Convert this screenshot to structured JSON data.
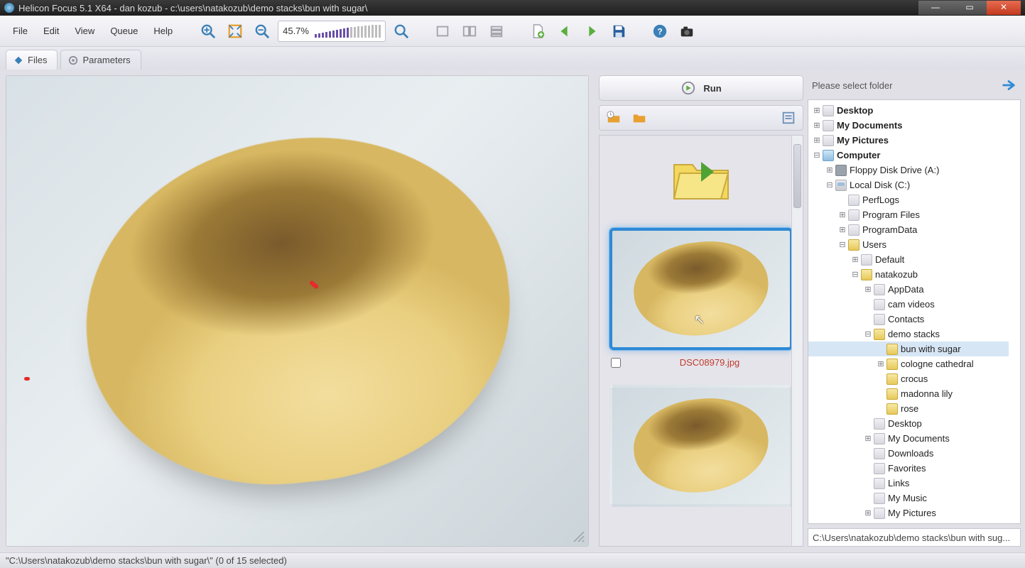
{
  "window": {
    "title": "Helicon Focus 5.1 X64 - dan kozub - c:\\users\\natakozub\\demo stacks\\bun with sugar\\"
  },
  "menu": {
    "file": "File",
    "edit": "Edit",
    "view": "View",
    "queue": "Queue",
    "help": "Help"
  },
  "toolbar": {
    "zoom_percent": "45.7%"
  },
  "tabs": {
    "files": "Files",
    "parameters": "Parameters"
  },
  "midpanel": {
    "run_label": "Run",
    "thumb_filename": "DSC08979.jpg"
  },
  "rightpanel": {
    "header": "Please select folder",
    "path": "C:\\Users\\natakozub\\demo stacks\\bun with sug..."
  },
  "tree": [
    {
      "d": 0,
      "tw": "+",
      "ic": "folder closed",
      "bold": true,
      "label": "Desktop"
    },
    {
      "d": 0,
      "tw": "+",
      "ic": "folder closed",
      "bold": true,
      "label": "My Documents"
    },
    {
      "d": 0,
      "tw": "+",
      "ic": "folder closed",
      "bold": true,
      "label": "My Pictures"
    },
    {
      "d": 0,
      "tw": "-",
      "ic": "pc",
      "bold": true,
      "label": "Computer"
    },
    {
      "d": 1,
      "tw": "+",
      "ic": "floppy",
      "label": "Floppy Disk Drive (A:)"
    },
    {
      "d": 1,
      "tw": "-",
      "ic": "drive",
      "label": "Local Disk (C:)"
    },
    {
      "d": 2,
      "tw": " ",
      "ic": "folder closed",
      "label": "PerfLogs"
    },
    {
      "d": 2,
      "tw": "+",
      "ic": "folder closed",
      "label": "Program Files"
    },
    {
      "d": 2,
      "tw": "+",
      "ic": "folder closed",
      "label": "ProgramData"
    },
    {
      "d": 2,
      "tw": "-",
      "ic": "folder",
      "label": "Users"
    },
    {
      "d": 3,
      "tw": "+",
      "ic": "folder closed",
      "label": "Default"
    },
    {
      "d": 3,
      "tw": "-",
      "ic": "folder",
      "label": "natakozub"
    },
    {
      "d": 4,
      "tw": "+",
      "ic": "folder closed",
      "label": "AppData"
    },
    {
      "d": 4,
      "tw": " ",
      "ic": "folder closed",
      "label": "cam videos"
    },
    {
      "d": 4,
      "tw": " ",
      "ic": "folder closed",
      "label": "Contacts"
    },
    {
      "d": 4,
      "tw": "-",
      "ic": "folder",
      "label": "demo stacks"
    },
    {
      "d": 5,
      "tw": " ",
      "ic": "folder",
      "sel": true,
      "label": "bun with sugar"
    },
    {
      "d": 5,
      "tw": "+",
      "ic": "folder",
      "label": "cologne cathedral"
    },
    {
      "d": 5,
      "tw": " ",
      "ic": "folder",
      "label": "crocus"
    },
    {
      "d": 5,
      "tw": " ",
      "ic": "folder",
      "label": "madonna lily"
    },
    {
      "d": 5,
      "tw": " ",
      "ic": "folder",
      "label": "rose"
    },
    {
      "d": 4,
      "tw": " ",
      "ic": "folder closed",
      "label": "Desktop"
    },
    {
      "d": 4,
      "tw": "+",
      "ic": "folder closed",
      "label": "My Documents"
    },
    {
      "d": 4,
      "tw": " ",
      "ic": "folder closed",
      "label": "Downloads"
    },
    {
      "d": 4,
      "tw": " ",
      "ic": "folder closed",
      "label": "Favorites"
    },
    {
      "d": 4,
      "tw": " ",
      "ic": "folder closed",
      "label": "Links"
    },
    {
      "d": 4,
      "tw": " ",
      "ic": "folder closed",
      "label": "My Music"
    },
    {
      "d": 4,
      "tw": "+",
      "ic": "folder closed",
      "label": "My Pictures"
    }
  ],
  "status": {
    "text": "\"C:\\Users\\natakozub\\demo stacks\\bun with sugar\\\" (0 of 15 selected)"
  }
}
